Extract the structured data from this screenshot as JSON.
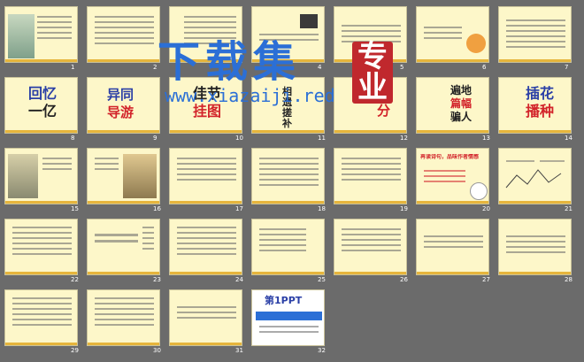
{
  "slide_numbers": [
    "1",
    "2",
    "3",
    "4",
    "5",
    "6",
    "7",
    "8",
    "9",
    "10",
    "11",
    "12",
    "13",
    "14",
    "15",
    "16",
    "17",
    "18",
    "19",
    "20",
    "21",
    "22",
    "23",
    "24",
    "25",
    "26",
    "27",
    "28",
    "29",
    "30",
    "31",
    "32"
  ],
  "words": {
    "s8a": "回忆",
    "s8b": "一亿",
    "s9a": "异同",
    "s9b": "导游",
    "s10a": "佳节",
    "s10b": "挂图",
    "s11": "相遗搓补",
    "s12": "倍分",
    "s13a": "遍地",
    "s13b": "篇幅",
    "s13c": "骗人",
    "s14a": "插花",
    "s14b": "播种",
    "s20": "再读诗句，品味作者情感",
    "s32": "第1PPT"
  },
  "watermark": {
    "line1": "下载集",
    "line2": "www.xiazaiji.red",
    "badge": "专业"
  },
  "colors": {
    "background": "#6b6b6b",
    "slide": "#fdf7c9",
    "accent_red": "#d2232a",
    "accent_blue": "#2a3fa6",
    "watermark": "#2b6fd6"
  }
}
